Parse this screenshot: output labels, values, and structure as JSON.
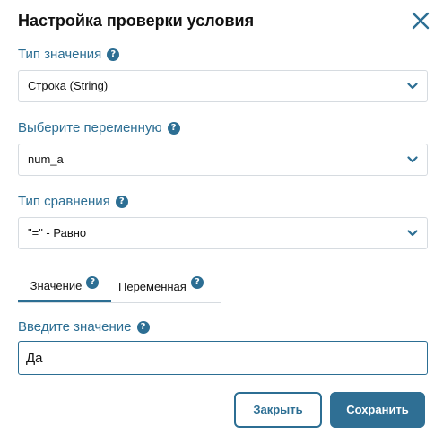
{
  "dialog": {
    "title": "Настройка проверки условия",
    "close_icon": "close-x-icon"
  },
  "colors": {
    "accent": "#2c6e93",
    "border": "#d6dbe0",
    "text": "#111111"
  },
  "value_type": {
    "label": "Тип значения",
    "help": "?",
    "selected": "Строка (String)"
  },
  "variable": {
    "label": "Выберите переменную",
    "help": "?",
    "selected": "num_a"
  },
  "comparison": {
    "label": "Тип сравнения",
    "help": "?",
    "selected": "\"=\" - Равно"
  },
  "tabs": [
    {
      "label": "Значение",
      "help": "?",
      "active": true
    },
    {
      "label": "Переменная",
      "help": "?",
      "active": false
    }
  ],
  "value_input": {
    "label": "Введите значение",
    "help": "?",
    "value": "Да"
  },
  "buttons": {
    "close_label": "Закрыть",
    "save_label": "Сохранить"
  }
}
